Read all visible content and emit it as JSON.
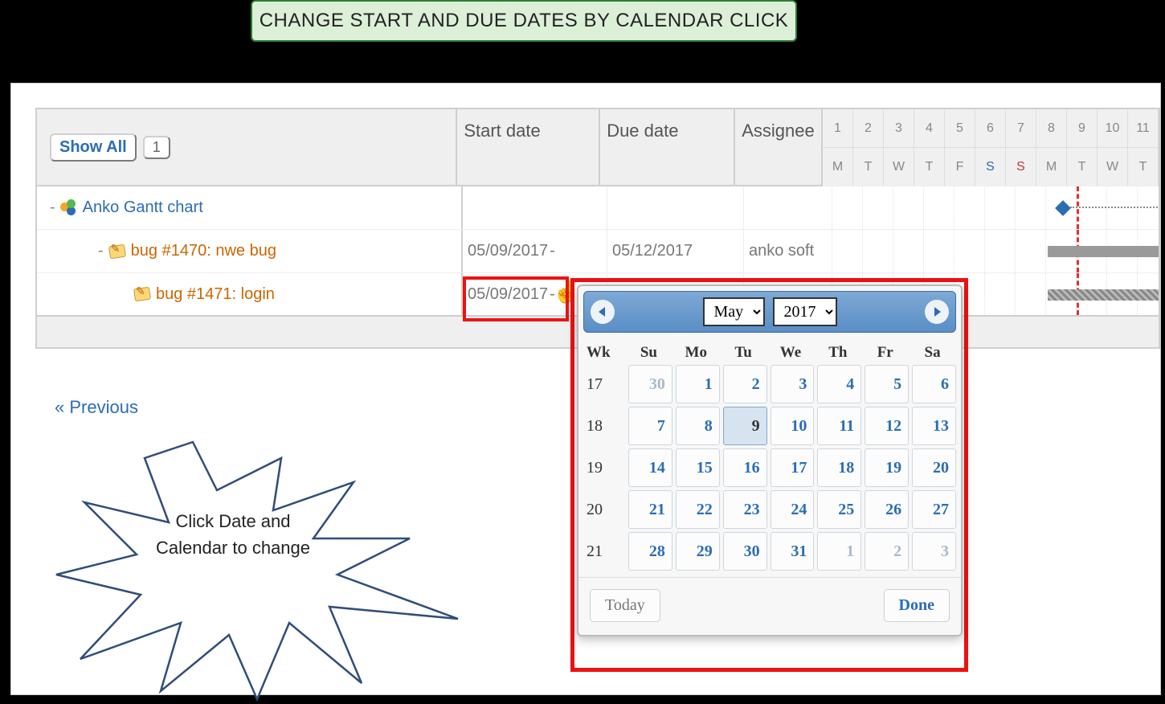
{
  "banner": {
    "title": "CHANGE START AND DUE DATES BY CALENDAR CLICK"
  },
  "toolbar": {
    "show_all_label": "Show All",
    "badge_value": "1"
  },
  "columns": {
    "start": "Start date",
    "due": "Due date",
    "assignee": "Assignee"
  },
  "timeline": {
    "day_numbers": [
      "1",
      "2",
      "3",
      "4",
      "5",
      "6",
      "7",
      "8",
      "9",
      "10",
      "11"
    ],
    "day_labels": [
      "M",
      "T",
      "W",
      "T",
      "F",
      "S",
      "S",
      "M",
      "T",
      "W",
      "T"
    ]
  },
  "tree": {
    "project": {
      "label": "Anko Gantt chart"
    },
    "rows": [
      {
        "label": "bug #1470: nwe bug",
        "start": "05/09/2017",
        "due": "05/12/2017",
        "assignee": "anko soft"
      },
      {
        "label": "bug #1471: login",
        "start": "05/09/2017",
        "due": "",
        "assignee": ""
      }
    ]
  },
  "prev_link": "« Previous",
  "callout": {
    "line1": "Click Date and",
    "line2": "Calendar to change"
  },
  "datepicker": {
    "month": "May",
    "year": "2017",
    "wk_label": "Wk",
    "dow": [
      "Su",
      "Mo",
      "Tu",
      "We",
      "Th",
      "Fr",
      "Sa"
    ],
    "weeks": [
      {
        "wk": "17",
        "days": [
          {
            "n": "30",
            "other": true
          },
          {
            "n": "1"
          },
          {
            "n": "2"
          },
          {
            "n": "3"
          },
          {
            "n": "4"
          },
          {
            "n": "5"
          },
          {
            "n": "6"
          }
        ]
      },
      {
        "wk": "18",
        "days": [
          {
            "n": "7"
          },
          {
            "n": "8"
          },
          {
            "n": "9",
            "selected": true
          },
          {
            "n": "10"
          },
          {
            "n": "11"
          },
          {
            "n": "12"
          },
          {
            "n": "13"
          }
        ]
      },
      {
        "wk": "19",
        "days": [
          {
            "n": "14"
          },
          {
            "n": "15"
          },
          {
            "n": "16"
          },
          {
            "n": "17"
          },
          {
            "n": "18"
          },
          {
            "n": "19"
          },
          {
            "n": "20"
          }
        ]
      },
      {
        "wk": "20",
        "days": [
          {
            "n": "21"
          },
          {
            "n": "22"
          },
          {
            "n": "23"
          },
          {
            "n": "24"
          },
          {
            "n": "25"
          },
          {
            "n": "26"
          },
          {
            "n": "27"
          }
        ]
      },
      {
        "wk": "21",
        "days": [
          {
            "n": "28"
          },
          {
            "n": "29"
          },
          {
            "n": "30"
          },
          {
            "n": "31"
          },
          {
            "n": "1",
            "other": true
          },
          {
            "n": "2",
            "other": true
          },
          {
            "n": "3",
            "other": true
          }
        ]
      }
    ],
    "today_label": "Today",
    "done_label": "Done"
  }
}
